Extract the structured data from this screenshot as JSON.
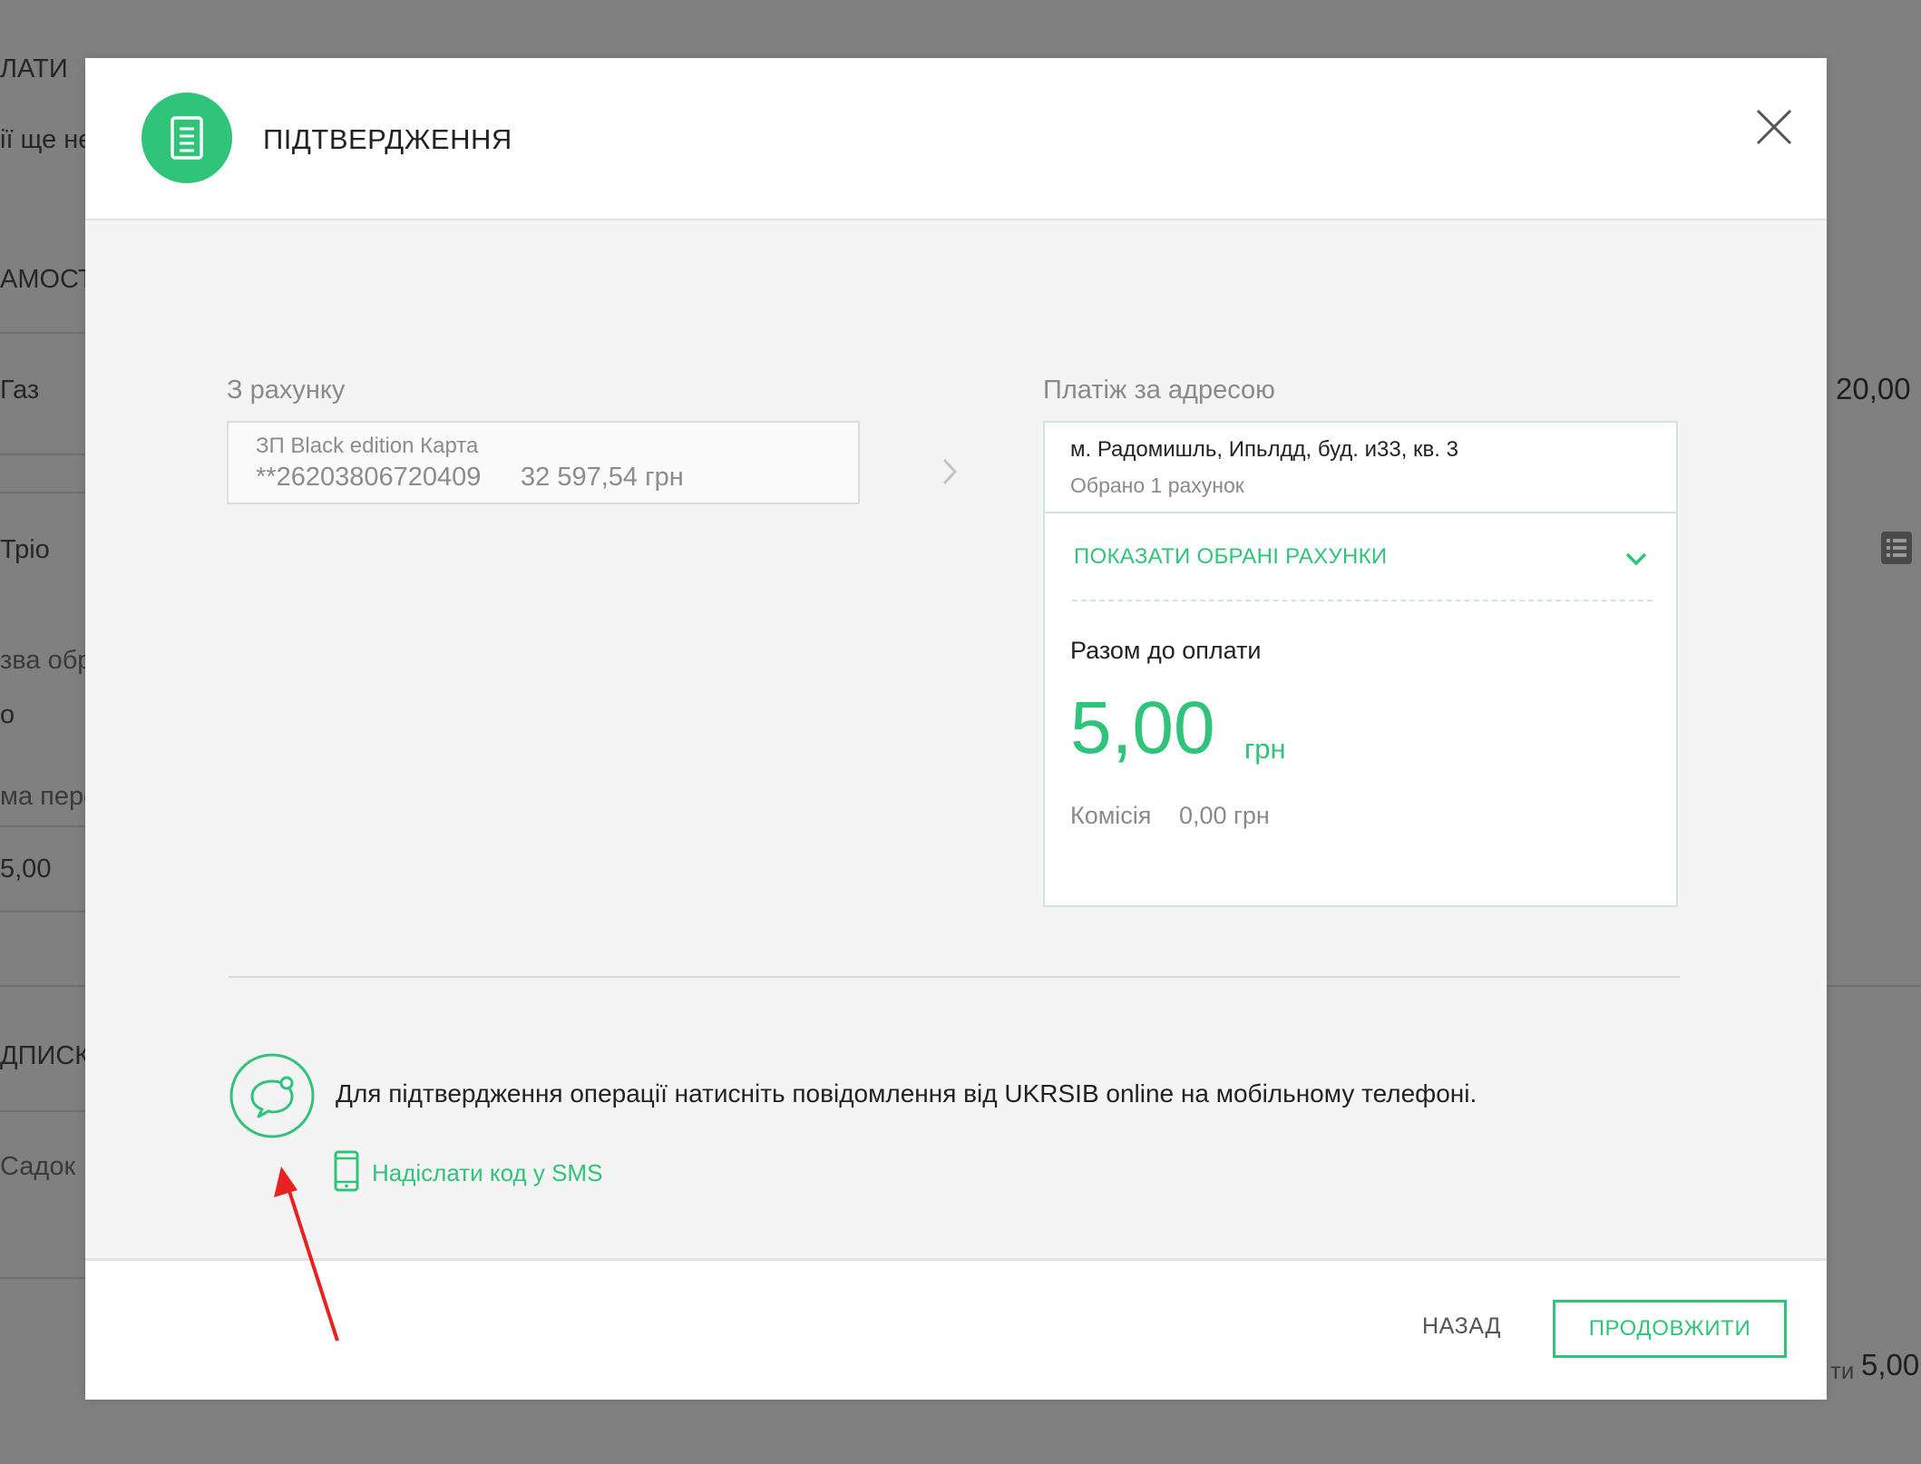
{
  "background": {
    "fragments": [
      "ЛАТИ",
      "ії ще не",
      "АМОСТІ",
      "Газ",
      "Тріо",
      "зва обр",
      "о",
      "ма пере",
      "5,00",
      "ДПИСКИ",
      "Садок",
      "ти"
    ],
    "right_values": [
      "20,00",
      "5,00"
    ]
  },
  "modal": {
    "title": "ПІДТВЕРДЖЕННЯ",
    "from_account": {
      "label": "З рахунку",
      "name": "ЗП Black edition Карта",
      "number": "**26203806720409",
      "balance": "32 597,54 грн"
    },
    "payee": {
      "label": "Платіж за адресою",
      "address": "м. Радомишль, Ипьлдд, буд. и33, кв. 3",
      "selected": "Обрано 1 рахунок",
      "show_accounts": "ПОКАЗАТИ ОБРАНІ РАХУНКИ",
      "total_label": "Разом до оплати",
      "total_amount": "5,00",
      "total_currency": "грн",
      "commission_label": "Комісія",
      "commission_value": "0,00 грн"
    },
    "confirmation": {
      "push_text": "Для підтвердження операції натисніть повідомлення від UKRSIB online на мобільному телефоні.",
      "sms_link": "Надіслати код у SMS"
    },
    "footer": {
      "back_label": "НАЗАД",
      "continue_label": "ПРОДОВЖИТИ"
    }
  },
  "colors": {
    "accent": "#2fc47a",
    "overlay": "#808080",
    "annotation": "#e8231f"
  },
  "icons": [
    "document-icon",
    "close-icon",
    "chevron-right-icon",
    "chevron-down-icon",
    "chat-bubble-icon",
    "phone-icon",
    "list-icon"
  ]
}
